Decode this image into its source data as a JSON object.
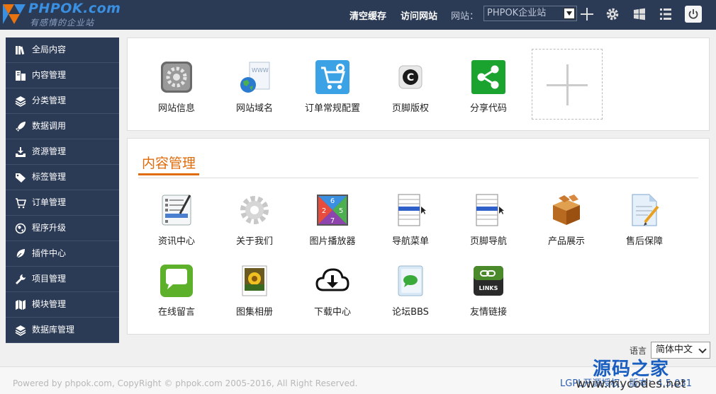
{
  "header": {
    "logo_text": "PHPOK.com",
    "logo_sub": "有感情的企业站",
    "clear_cache": "清空缓存",
    "visit_site": "访问网站",
    "site_label": "网站：",
    "site_value": "PHPOK企业站"
  },
  "sidebar": {
    "items": [
      {
        "label": "全局内容",
        "icon": "books-icon"
      },
      {
        "label": "内容管理",
        "icon": "building-icon"
      },
      {
        "label": "分类管理",
        "icon": "layers-icon"
      },
      {
        "label": "数据调用",
        "icon": "rocket-icon"
      },
      {
        "label": "资源管理",
        "icon": "download-tray-icon"
      },
      {
        "label": "标签管理",
        "icon": "tags-icon"
      },
      {
        "label": "订单管理",
        "icon": "cart-icon"
      },
      {
        "label": "程序升级",
        "icon": "globe-icon"
      },
      {
        "label": "插件中心",
        "icon": "leaf-icon"
      },
      {
        "label": "项目管理",
        "icon": "wrench-icon"
      },
      {
        "label": "模块管理",
        "icon": "map-icon"
      },
      {
        "label": "数据库管理",
        "icon": "database-icon"
      }
    ]
  },
  "quick": {
    "items": [
      {
        "label": "网站信息",
        "icon": "site-info-icon"
      },
      {
        "label": "网站域名",
        "icon": "domain-icon"
      },
      {
        "label": "订单常规配置",
        "icon": "order-config-icon"
      },
      {
        "label": "页脚版权",
        "icon": "copyright-icon"
      },
      {
        "label": "分享代码",
        "icon": "share-icon"
      }
    ]
  },
  "content": {
    "title": "内容管理",
    "items": [
      {
        "label": "资讯中心",
        "icon": "news-icon"
      },
      {
        "label": "关于我们",
        "icon": "about-icon"
      },
      {
        "label": "图片播放器",
        "icon": "slideshow-icon"
      },
      {
        "label": "导航菜单",
        "icon": "nav-menu-icon"
      },
      {
        "label": "页脚导航",
        "icon": "footer-nav-icon"
      },
      {
        "label": "产品展示",
        "icon": "product-icon"
      },
      {
        "label": "售后保障",
        "icon": "aftersale-icon"
      },
      {
        "label": "在线留言",
        "icon": "message-icon"
      },
      {
        "label": "图集相册",
        "icon": "album-icon"
      },
      {
        "label": "下载中心",
        "icon": "cloud-download-icon"
      },
      {
        "label": "论坛BBS",
        "icon": "forum-icon"
      },
      {
        "label": "友情链接",
        "icon": "links-icon"
      }
    ]
  },
  "lang": {
    "label": "语言",
    "value": "简体中文"
  },
  "footer": {
    "copyright": "Powered by phpok.com, CopyRight © phpok.com 2005-2016, All Right Reserved.",
    "license": "LGPL开源授权，版本：4.5.031",
    "watermark_cn": "源码之家",
    "watermark_url": "www.mycodes.net"
  }
}
